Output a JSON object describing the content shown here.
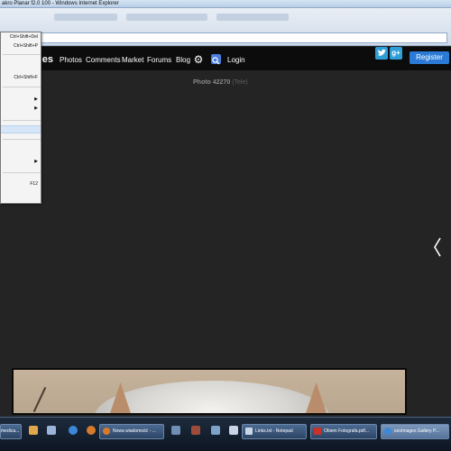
{
  "window": {
    "title": "akro Planar f2.0 100 - Windows Internet Explorer"
  },
  "navbar": {
    "logo_fragment": "ges",
    "links": [
      "Photos",
      "Comments",
      "Market",
      "Forums",
      "Blog"
    ],
    "login": "Login",
    "gplus": "g+",
    "register": "Register"
  },
  "photo": {
    "label": "Photo 42270",
    "sub": "(Tele)"
  },
  "context_menu": {
    "shortcuts": {
      "delete_history": "Ctrl+Shift+Del",
      "inprivate": "Ctrl+Shift+P",
      "filtering": "Ctrl+Shift+F",
      "devtools": "F12"
    }
  },
  "taskbar": {
    "items": [
      "medica...",
      "Nowa wiadomość - ...",
      "Links.txt - Notepad",
      "Obiem Fotografa.pdf...",
      "ezoImages Gallery P..."
    ]
  },
  "colors": {
    "page_bg": "#242424",
    "navbar_bg": "#0c0c0c",
    "register_blue": "#2b7bd6",
    "social_blue": "#2f9ed8"
  }
}
